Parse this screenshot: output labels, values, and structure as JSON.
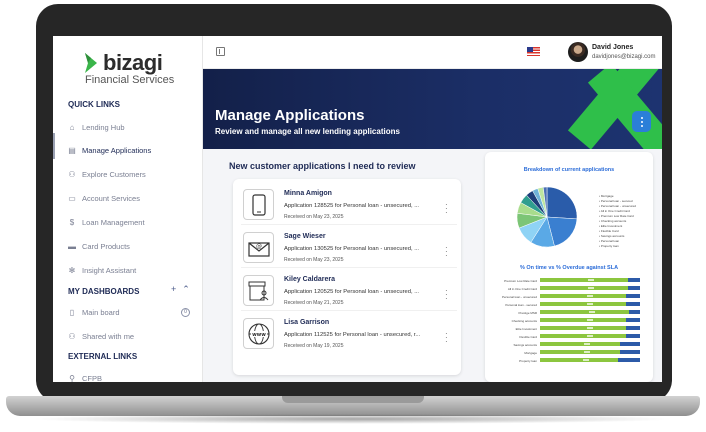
{
  "sidebar": {
    "logo_text": "bizagi",
    "logo_sub": "Financial Services",
    "quick_links_title": "QUICK LINKS",
    "quick_links": [
      {
        "label": "Lending Hub",
        "icon": "home-icon"
      },
      {
        "label": "Manage Applications",
        "icon": "clipboard-icon",
        "active": true
      },
      {
        "label": "Explore Customers",
        "icon": "users-icon"
      },
      {
        "label": "Account Services",
        "icon": "account-icon"
      },
      {
        "label": "Loan Management",
        "icon": "money-icon"
      },
      {
        "label": "Card Products",
        "icon": "card-icon"
      },
      {
        "label": "Insight Assistant",
        "icon": "sparkle-icon"
      }
    ],
    "dashboards_title": "MY DASHBOARDS",
    "dashboards": [
      {
        "label": "Main board",
        "icon": "bookmark-icon",
        "badge": "0"
      },
      {
        "label": "Shared with me",
        "icon": "share-icon"
      }
    ],
    "external_title": "EXTERNAL LINKS",
    "external": [
      {
        "label": "CFPB",
        "icon": "link-icon"
      }
    ]
  },
  "topbar": {
    "user_name": "David Jones",
    "user_email": "davidjones@bizagi.com"
  },
  "banner": {
    "title": "Manage Applications",
    "subtitle": "Review and manage all new lending applications"
  },
  "applications": {
    "title": "New customer applications I need to review",
    "items": [
      {
        "name": "Minna Amigon",
        "desc": "Application 128525 for Personal loan - unsecured, ...",
        "date": "Received on May 23, 2025",
        "icon": "phone-icon"
      },
      {
        "name": "Sage Wieser",
        "desc": "Application 130525 for Personal loan - unsecured, ...",
        "date": "Received on May 23, 2025",
        "icon": "envelope-icon"
      },
      {
        "name": "Kiley Caldarera",
        "desc": "Application 120525 for Personal loan - unsecured, ...",
        "date": "Received on May 21, 2025",
        "icon": "branch-icon"
      },
      {
        "name": "Lisa Garrison",
        "desc": "Application 112525 for Personal loan - unsecured, r...",
        "date": "Received on May 19, 2025",
        "icon": "web-icon"
      }
    ]
  },
  "chart_data": [
    {
      "type": "pie",
      "title": "Breakdown of current applications",
      "categories": [
        "Mortgage",
        "Personal loan - secured",
        "Personal loan - unsecured",
        "All in One Credit Card",
        "Premium Low Rate Card",
        "Checking accounts",
        "Elite Investment",
        "Flexible Card",
        "Savings accounts",
        "Personal loan",
        "Property loan"
      ],
      "values": [
        26,
        20,
        13,
        10,
        8,
        6,
        5,
        4,
        3,
        3,
        2
      ],
      "colors": [
        "#2a5caa",
        "#3a7fd0",
        "#5aa9e6",
        "#8fd3f5",
        "#7cc576",
        "#a8dc8c",
        "#2f9e8f",
        "#1e3f7a",
        "#6fb3d8",
        "#bde6a0",
        "#4b6fb5"
      ]
    },
    {
      "type": "bar",
      "title": "% On time vs % Overdue against SLA",
      "categories": [
        "Premium Low Rate Card",
        "All in One Credit Card",
        "Personal loan - unsecured",
        "Personal loan - secured",
        "Prestige MSR",
        "Checking accounts",
        "Elite Investment",
        "Flexible Card",
        "Savings accounts",
        "Mortgage",
        "Property loan"
      ],
      "series": [
        {
          "name": "% On time",
          "values": [
            88,
            88,
            86,
            86,
            89,
            86,
            86,
            86,
            80,
            80,
            78
          ],
          "color": "#8cc63f"
        },
        {
          "name": "% Overdue",
          "values": [
            12,
            12,
            14,
            14,
            11,
            14,
            14,
            14,
            20,
            20,
            22
          ],
          "color": "#2c5aa8"
        }
      ],
      "xlim": [
        0,
        100
      ]
    }
  ]
}
